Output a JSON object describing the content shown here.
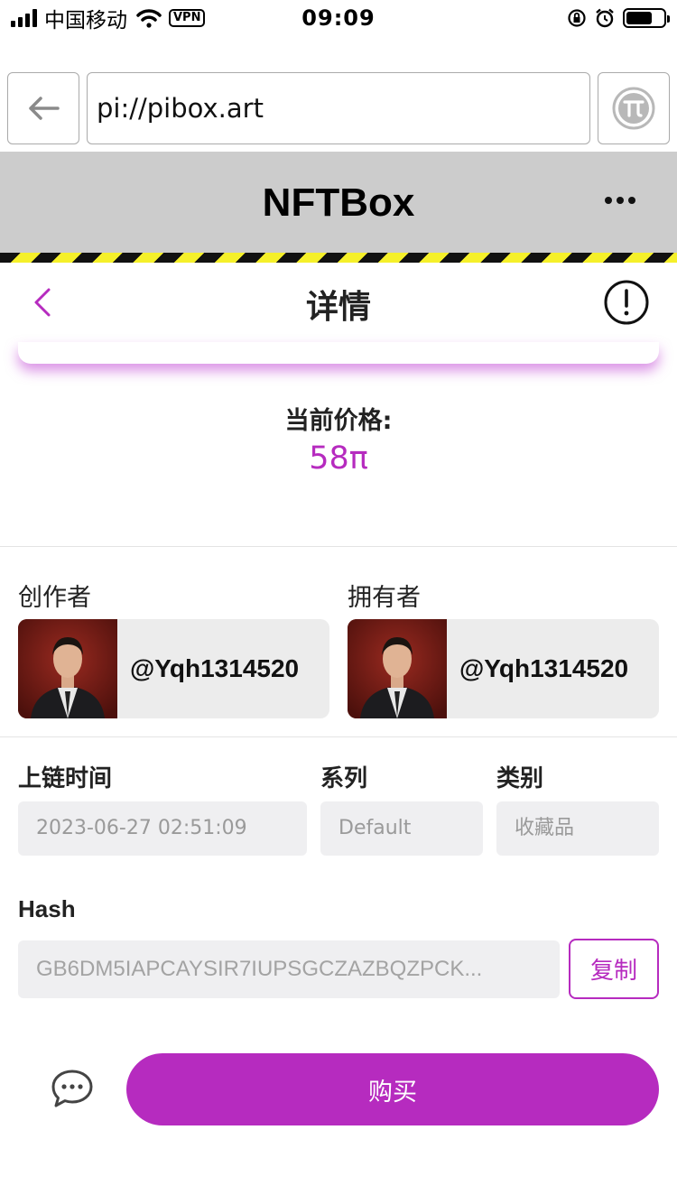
{
  "status_bar": {
    "carrier": "中国移动",
    "vpn_label": "VPN",
    "time": "09:09",
    "icons": [
      "signal-icon",
      "wifi-icon",
      "rotation-lock-icon",
      "alarm-icon",
      "battery-icon"
    ],
    "battery_level": 0.7
  },
  "browser": {
    "url": "pi://pibox.art",
    "back_icon": "arrow-left-icon",
    "pi_icon": "pi-logo-icon"
  },
  "app_header": {
    "title": "NFTBox",
    "more_icon": "more-dots-icon"
  },
  "nav": {
    "title": "详情",
    "back_icon": "chevron-left-icon",
    "info_icon": "info-icon"
  },
  "price": {
    "label": "当前价格:",
    "value": "58π"
  },
  "creator": {
    "label": "创作者",
    "name": "@Yqh1314520"
  },
  "owner": {
    "label": "拥有者",
    "name": "@Yqh1314520"
  },
  "details": {
    "chain_time_label": "上链时间",
    "chain_time_value": "2023-06-27 02:51:09",
    "series_label": "系列",
    "series_value": "Default",
    "category_label": "类别",
    "category_value": "收藏品"
  },
  "hash": {
    "label": "Hash",
    "value": "GB6DM5IAPCAYSIR7IUPSGCZAZBQZPCK...",
    "copy_label": "复制"
  },
  "bottom": {
    "chat_icon": "chat-bubble-icon",
    "buy_label": "购买"
  },
  "colors": {
    "accent": "#b62bbf",
    "header_bg": "#cccccc",
    "hazard_yellow": "#f5f02a",
    "field_bg": "#efeff1"
  }
}
